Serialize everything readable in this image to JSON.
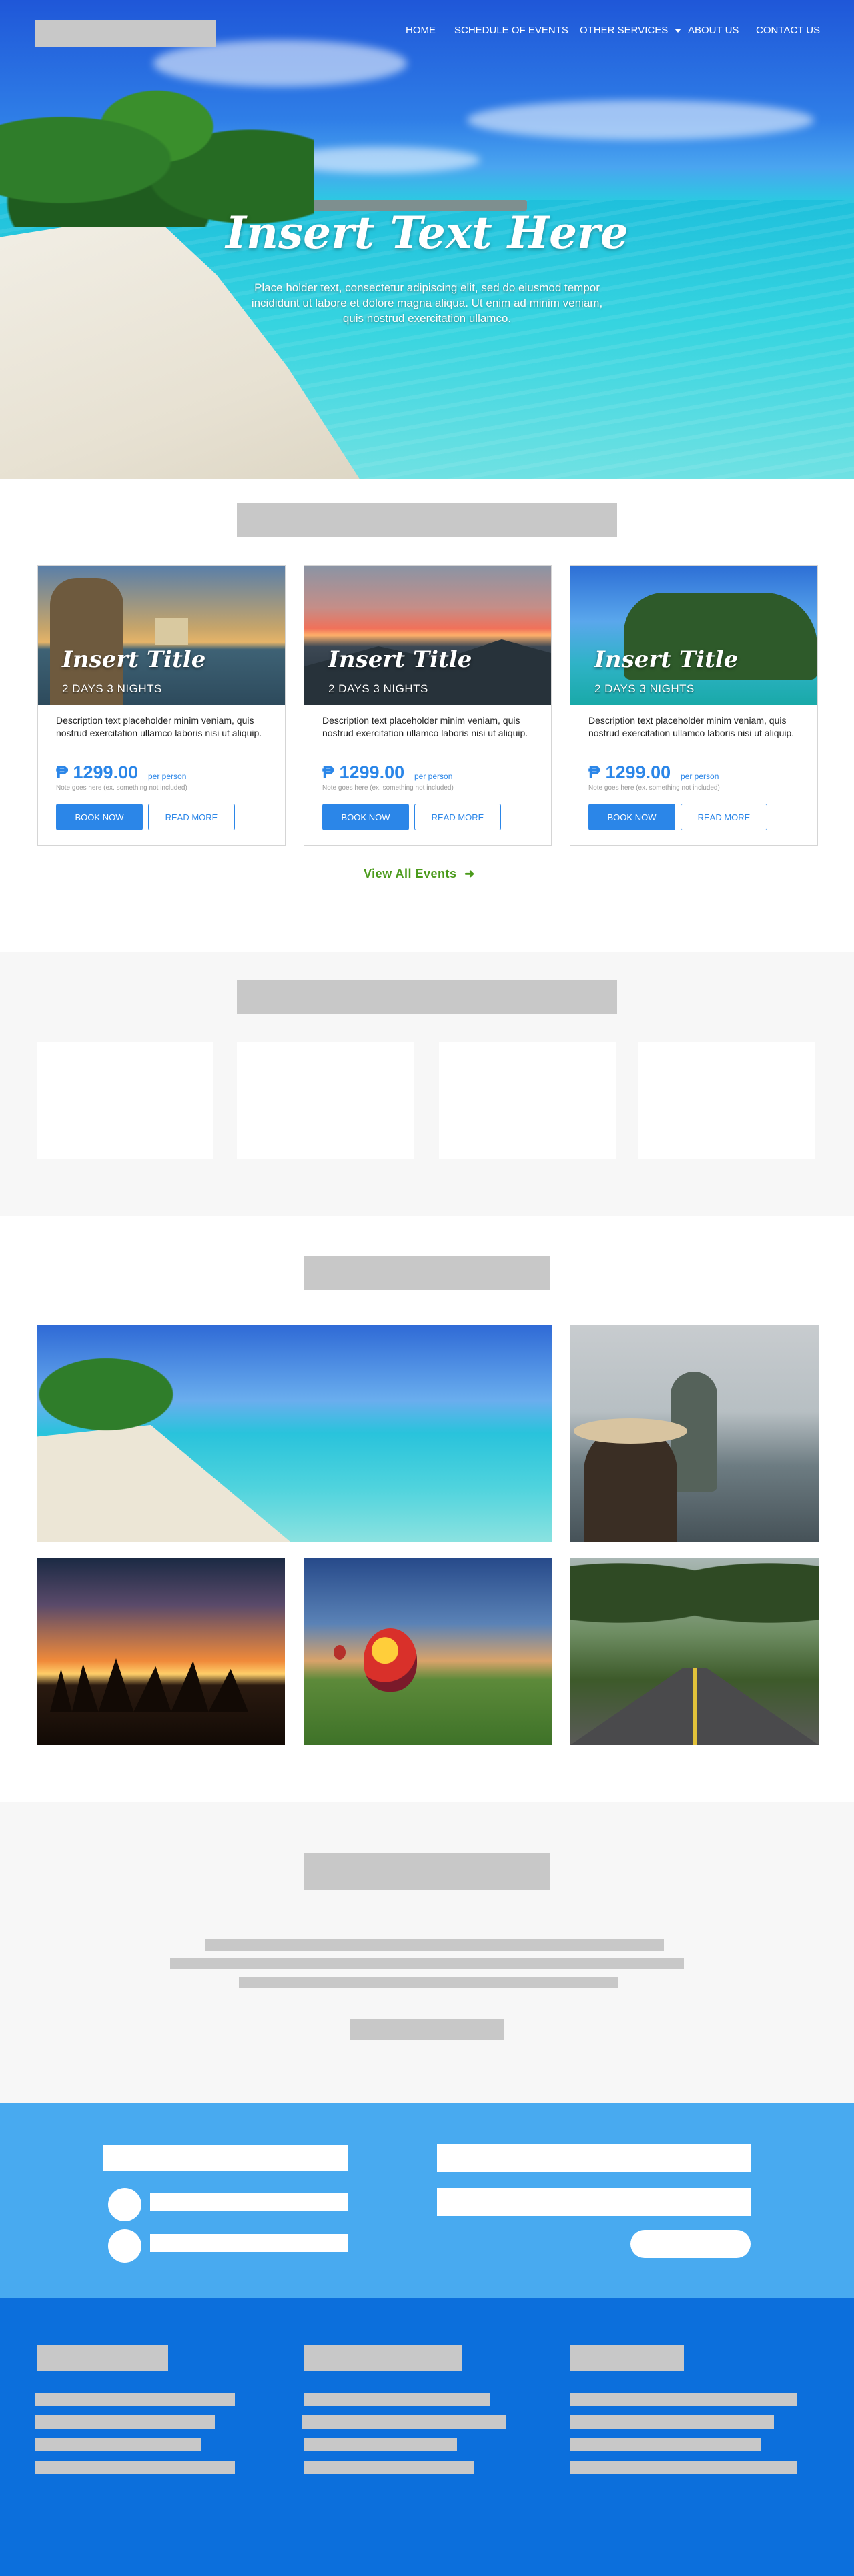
{
  "nav": {
    "home": "HOME",
    "schedule": "SCHEDULE OF EVENTS",
    "other": "OTHER SERVICES",
    "about": "ABOUT US",
    "contact": "CONTACT US"
  },
  "hero": {
    "title": "Insert Text Here",
    "subtitle": "Place holder text, consectetur adipiscing elit, sed do eiusmod tempor incididunt ut labore et dolore magna aliqua. Ut enim ad minim veniam, quis nostrud exercitation ullamco."
  },
  "cards": [
    {
      "title": "Insert Title",
      "days": "2 DAYS 3 NIGHTS",
      "desc": "Description text placeholder minim veniam, quis nostrud exercitation ullamco laboris nisi ut aliquip.",
      "price": "₱ 1299.00",
      "per": "per person",
      "note": "Note goes here (ex. something not included)",
      "book": "BOOK NOW",
      "more": "READ MORE"
    },
    {
      "title": "Insert Title",
      "days": "2 DAYS 3 NIGHTS",
      "desc": "Description text placeholder minim veniam, quis nostrud exercitation ullamco laboris nisi ut aliquip.",
      "price": "₱ 1299.00",
      "per": "per person",
      "note": "Note goes here (ex. something not included)",
      "book": "BOOK NOW",
      "more": "READ MORE"
    },
    {
      "title": "Insert Title",
      "days": "2 DAYS 3 NIGHTS",
      "desc": "Description text placeholder minim veniam, quis nostrud exercitation ullamco laboris nisi ut aliquip.",
      "price": "₱ 1299.00",
      "per": "per person",
      "note": "Note goes here (ex. something not included)",
      "book": "BOOK NOW",
      "more": "READ MORE"
    }
  ],
  "events": {
    "view_all": "View All Events"
  },
  "colors": {
    "accent": "#2b86e8",
    "link_green": "#4a9a1a",
    "contact_band": "#48aaf0",
    "footer": "#0c6fdc",
    "placeholder": "#c8c8c8",
    "light_section": "#f7f7f7"
  },
  "icons": {
    "dropdown": "caret-down-icon",
    "arrow": "arrow-right-icon"
  }
}
